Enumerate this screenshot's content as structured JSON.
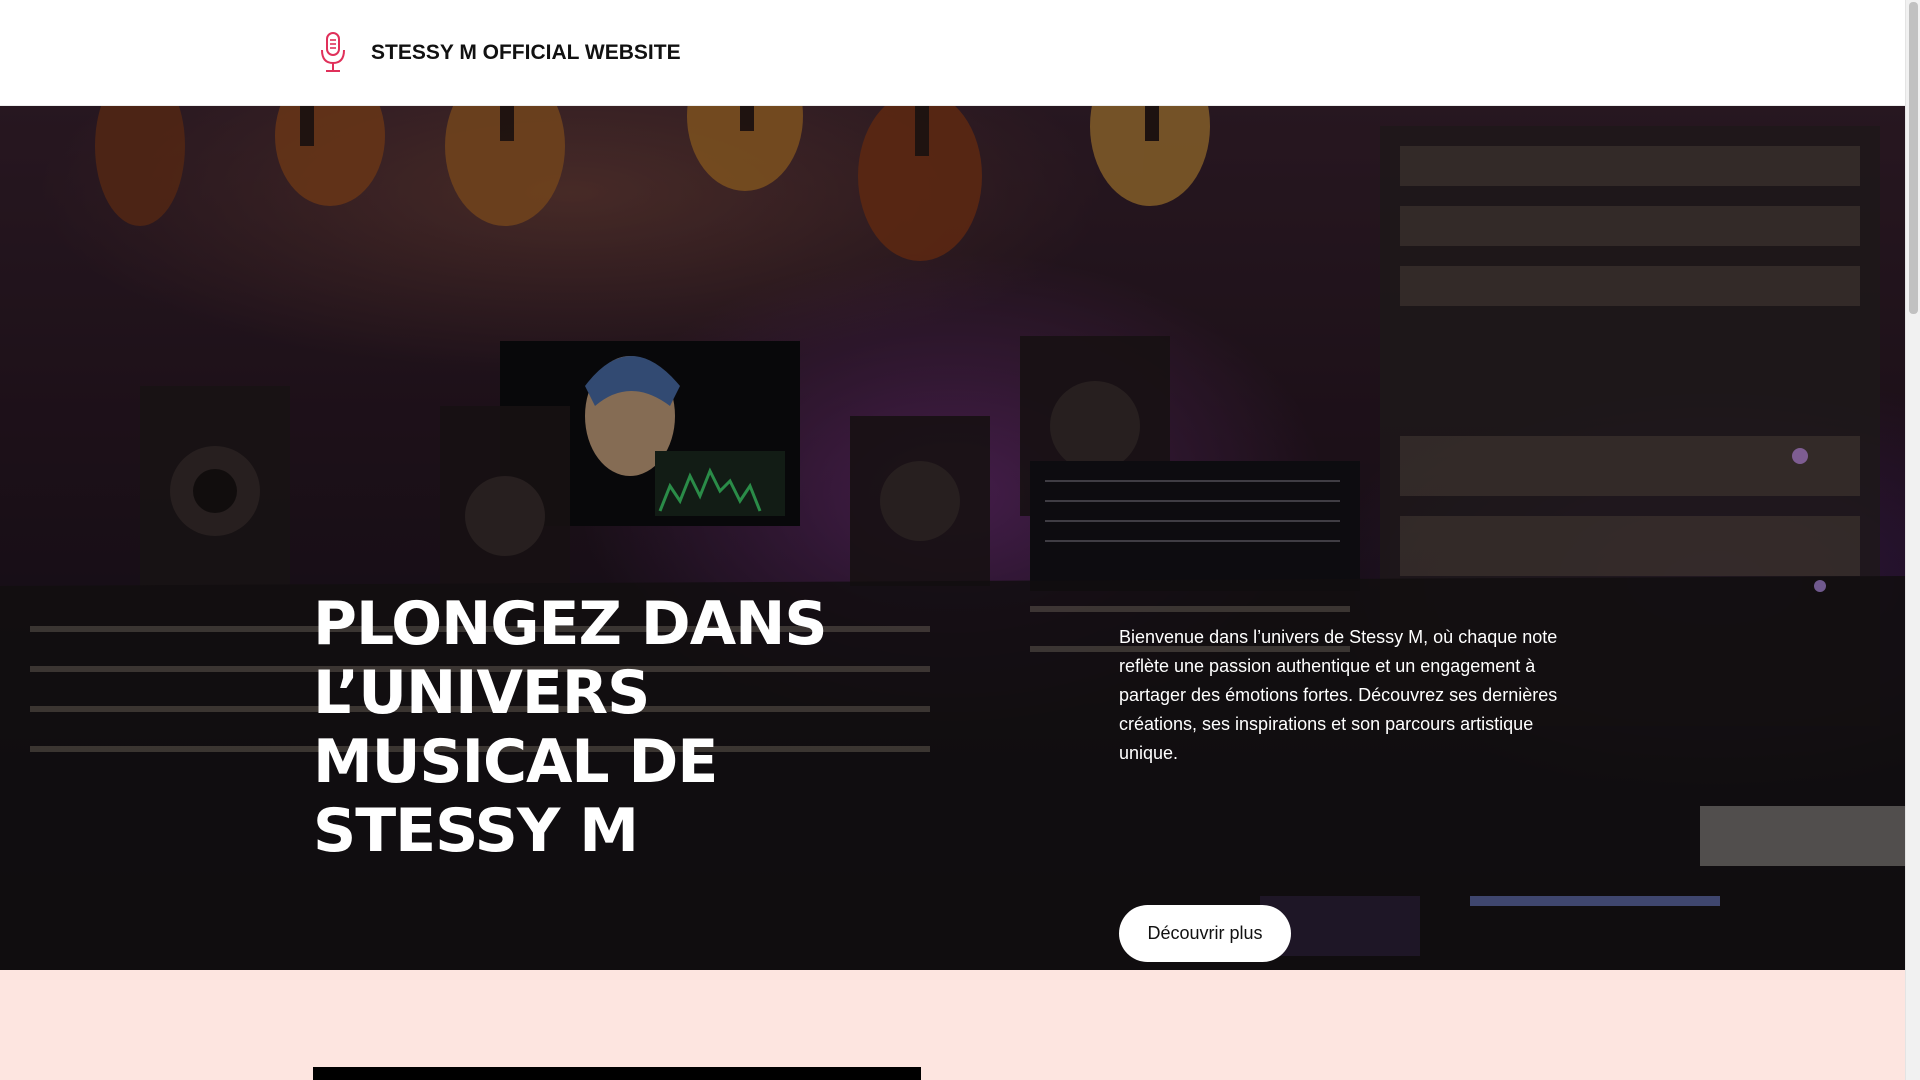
{
  "header": {
    "site_title": "STESSY M OFFICIAL WEBSITE",
    "logo_icon": "microphone-icon",
    "accent_color": "#e0305a"
  },
  "hero": {
    "heading": "PLONGEZ DANS L’UNIVERS MUSICAL DE STESSY M",
    "text": "Bienvenue dans l’univers de Stessy M, où chaque note reflète une passion authentique et un engagement à partager des émotions fortes. Découvrez ses dernières créations, ses inspirations et son parcours artistique unique.",
    "button_label": "Découvrir plus",
    "background": "music-studio-photo"
  },
  "section_two": {
    "background_color": "#fde5e0"
  }
}
